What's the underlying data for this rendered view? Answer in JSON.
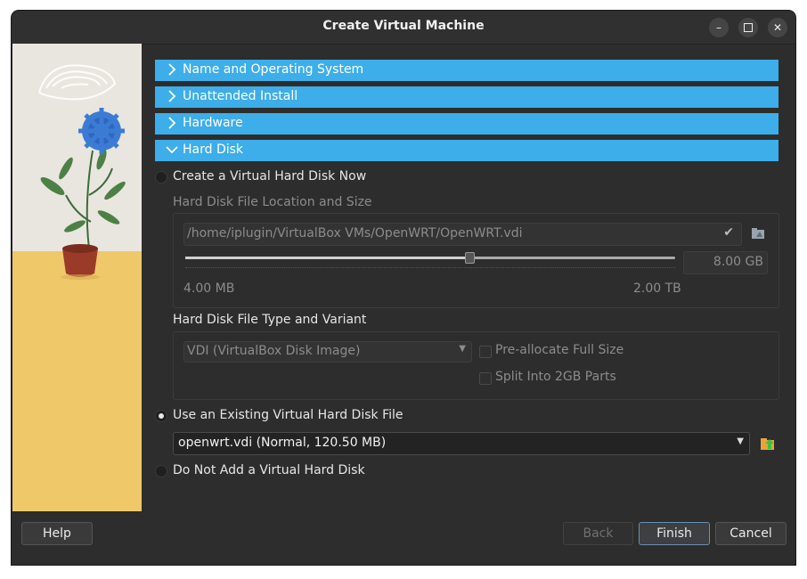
{
  "window": {
    "title": "Create Virtual Machine"
  },
  "sections": [
    {
      "label": "Name and Operating System",
      "expanded": false
    },
    {
      "label": "Unattended Install",
      "expanded": false
    },
    {
      "label": "Hardware",
      "expanded": false
    },
    {
      "label": "Hard Disk",
      "expanded": true
    }
  ],
  "hard_disk": {
    "option_create": "Create a Virtual Hard Disk Now",
    "location_size_title": "Hard Disk File Location and Size",
    "path_value": "/home/iplugin/VirtualBox VMs/OpenWRT/OpenWRT.vdi",
    "size_value": "8.00 GB",
    "size_min": "4.00 MB",
    "size_max": "2.00 TB",
    "slider_fraction": 0.57,
    "type_title": "Hard Disk File Type and Variant",
    "type_value": "VDI (VirtualBox Disk Image)",
    "preallocate_label": "Pre-allocate Full Size",
    "split_label": "Split Into 2GB Parts",
    "option_existing": "Use an Existing Virtual Hard Disk File",
    "existing_value": "openwrt.vdi (Normal, 120.50 MB)",
    "option_none": "Do Not Add a Virtual Hard Disk",
    "selected_option": "existing"
  },
  "footer": {
    "help": "Help",
    "back": "Back",
    "finish": "Finish",
    "cancel": "Cancel"
  },
  "colors": {
    "section_bg": "#3daee9",
    "window_bg": "#2d2d2d"
  }
}
